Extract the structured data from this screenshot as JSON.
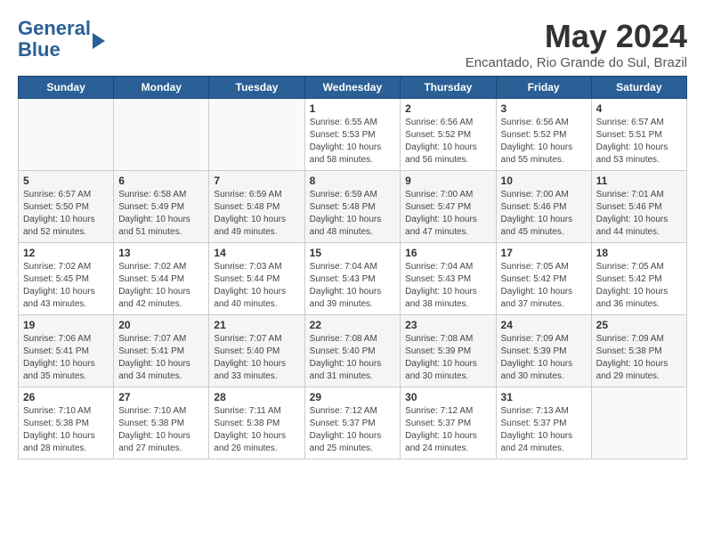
{
  "logo": {
    "line1": "General",
    "line2": "Blue"
  },
  "title": "May 2024",
  "location": "Encantado, Rio Grande do Sul, Brazil",
  "days_of_week": [
    "Sunday",
    "Monday",
    "Tuesday",
    "Wednesday",
    "Thursday",
    "Friday",
    "Saturday"
  ],
  "weeks": [
    [
      {
        "day": "",
        "info": ""
      },
      {
        "day": "",
        "info": ""
      },
      {
        "day": "",
        "info": ""
      },
      {
        "day": "1",
        "info": "Sunrise: 6:55 AM\nSunset: 5:53 PM\nDaylight: 10 hours\nand 58 minutes."
      },
      {
        "day": "2",
        "info": "Sunrise: 6:56 AM\nSunset: 5:52 PM\nDaylight: 10 hours\nand 56 minutes."
      },
      {
        "day": "3",
        "info": "Sunrise: 6:56 AM\nSunset: 5:52 PM\nDaylight: 10 hours\nand 55 minutes."
      },
      {
        "day": "4",
        "info": "Sunrise: 6:57 AM\nSunset: 5:51 PM\nDaylight: 10 hours\nand 53 minutes."
      }
    ],
    [
      {
        "day": "5",
        "info": "Sunrise: 6:57 AM\nSunset: 5:50 PM\nDaylight: 10 hours\nand 52 minutes."
      },
      {
        "day": "6",
        "info": "Sunrise: 6:58 AM\nSunset: 5:49 PM\nDaylight: 10 hours\nand 51 minutes."
      },
      {
        "day": "7",
        "info": "Sunrise: 6:59 AM\nSunset: 5:48 PM\nDaylight: 10 hours\nand 49 minutes."
      },
      {
        "day": "8",
        "info": "Sunrise: 6:59 AM\nSunset: 5:48 PM\nDaylight: 10 hours\nand 48 minutes."
      },
      {
        "day": "9",
        "info": "Sunrise: 7:00 AM\nSunset: 5:47 PM\nDaylight: 10 hours\nand 47 minutes."
      },
      {
        "day": "10",
        "info": "Sunrise: 7:00 AM\nSunset: 5:46 PM\nDaylight: 10 hours\nand 45 minutes."
      },
      {
        "day": "11",
        "info": "Sunrise: 7:01 AM\nSunset: 5:46 PM\nDaylight: 10 hours\nand 44 minutes."
      }
    ],
    [
      {
        "day": "12",
        "info": "Sunrise: 7:02 AM\nSunset: 5:45 PM\nDaylight: 10 hours\nand 43 minutes."
      },
      {
        "day": "13",
        "info": "Sunrise: 7:02 AM\nSunset: 5:44 PM\nDaylight: 10 hours\nand 42 minutes."
      },
      {
        "day": "14",
        "info": "Sunrise: 7:03 AM\nSunset: 5:44 PM\nDaylight: 10 hours\nand 40 minutes."
      },
      {
        "day": "15",
        "info": "Sunrise: 7:04 AM\nSunset: 5:43 PM\nDaylight: 10 hours\nand 39 minutes."
      },
      {
        "day": "16",
        "info": "Sunrise: 7:04 AM\nSunset: 5:43 PM\nDaylight: 10 hours\nand 38 minutes."
      },
      {
        "day": "17",
        "info": "Sunrise: 7:05 AM\nSunset: 5:42 PM\nDaylight: 10 hours\nand 37 minutes."
      },
      {
        "day": "18",
        "info": "Sunrise: 7:05 AM\nSunset: 5:42 PM\nDaylight: 10 hours\nand 36 minutes."
      }
    ],
    [
      {
        "day": "19",
        "info": "Sunrise: 7:06 AM\nSunset: 5:41 PM\nDaylight: 10 hours\nand 35 minutes."
      },
      {
        "day": "20",
        "info": "Sunrise: 7:07 AM\nSunset: 5:41 PM\nDaylight: 10 hours\nand 34 minutes."
      },
      {
        "day": "21",
        "info": "Sunrise: 7:07 AM\nSunset: 5:40 PM\nDaylight: 10 hours\nand 33 minutes."
      },
      {
        "day": "22",
        "info": "Sunrise: 7:08 AM\nSunset: 5:40 PM\nDaylight: 10 hours\nand 31 minutes."
      },
      {
        "day": "23",
        "info": "Sunrise: 7:08 AM\nSunset: 5:39 PM\nDaylight: 10 hours\nand 30 minutes."
      },
      {
        "day": "24",
        "info": "Sunrise: 7:09 AM\nSunset: 5:39 PM\nDaylight: 10 hours\nand 30 minutes."
      },
      {
        "day": "25",
        "info": "Sunrise: 7:09 AM\nSunset: 5:38 PM\nDaylight: 10 hours\nand 29 minutes."
      }
    ],
    [
      {
        "day": "26",
        "info": "Sunrise: 7:10 AM\nSunset: 5:38 PM\nDaylight: 10 hours\nand 28 minutes."
      },
      {
        "day": "27",
        "info": "Sunrise: 7:10 AM\nSunset: 5:38 PM\nDaylight: 10 hours\nand 27 minutes."
      },
      {
        "day": "28",
        "info": "Sunrise: 7:11 AM\nSunset: 5:38 PM\nDaylight: 10 hours\nand 26 minutes."
      },
      {
        "day": "29",
        "info": "Sunrise: 7:12 AM\nSunset: 5:37 PM\nDaylight: 10 hours\nand 25 minutes."
      },
      {
        "day": "30",
        "info": "Sunrise: 7:12 AM\nSunset: 5:37 PM\nDaylight: 10 hours\nand 24 minutes."
      },
      {
        "day": "31",
        "info": "Sunrise: 7:13 AM\nSunset: 5:37 PM\nDaylight: 10 hours\nand 24 minutes."
      },
      {
        "day": "",
        "info": ""
      }
    ]
  ]
}
